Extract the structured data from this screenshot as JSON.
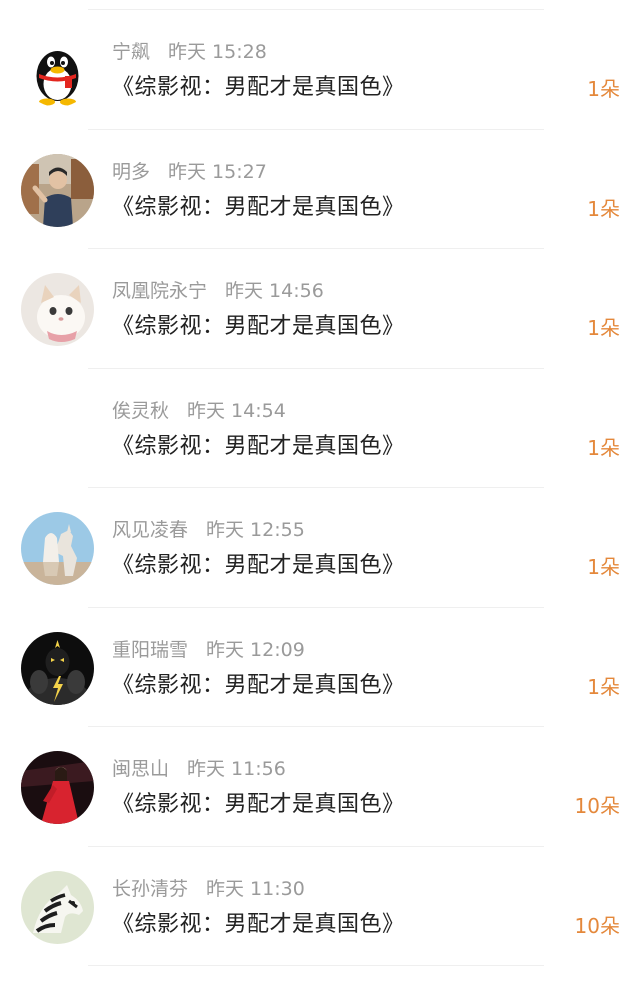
{
  "gifts": [
    {
      "user": "宁飙",
      "time": "昨天 15:28",
      "title": "《综影视：男配才是真国色》",
      "amount": "1朵",
      "avatar_icon": "qq-penguin-avatar"
    },
    {
      "user": "明多",
      "time": "昨天 15:27",
      "title": "《综影视：男配才是真国色》",
      "amount": "1朵",
      "avatar_icon": "boy-photo-avatar"
    },
    {
      "user": "凤凰院永宁",
      "time": "昨天 14:56",
      "title": "《综影视：男配才是真国色》",
      "amount": "1朵",
      "avatar_icon": "white-cat-avatar"
    },
    {
      "user": "俟灵秋",
      "time": "昨天 14:54",
      "title": "《综影视：男配才是真国色》",
      "amount": "1朵",
      "avatar_icon": "blank-avatar"
    },
    {
      "user": "风见凌春",
      "time": "昨天 12:55",
      "title": "《综影视：男配才是真国色》",
      "amount": "1朵",
      "avatar_icon": "horse-rider-avatar"
    },
    {
      "user": "重阳瑞雪",
      "time": "昨天 12:09",
      "title": "《综影视：男配才是真国色》",
      "amount": "1朵",
      "avatar_icon": "dark-hero-avatar"
    },
    {
      "user": "闽思山",
      "time": "昨天 11:56",
      "title": "《综影视：男配才是真国色》",
      "amount": "10朵",
      "avatar_icon": "red-dress-avatar"
    },
    {
      "user": "长孙清芬",
      "time": "昨天 11:30",
      "title": "《综影视：男配才是真国色》",
      "amount": "10朵",
      "avatar_icon": "zebra-avatar"
    }
  ],
  "colors": {
    "amount": "#e4883b",
    "meta": "#9a9a9a",
    "title": "#222222",
    "divider": "#efefef"
  }
}
